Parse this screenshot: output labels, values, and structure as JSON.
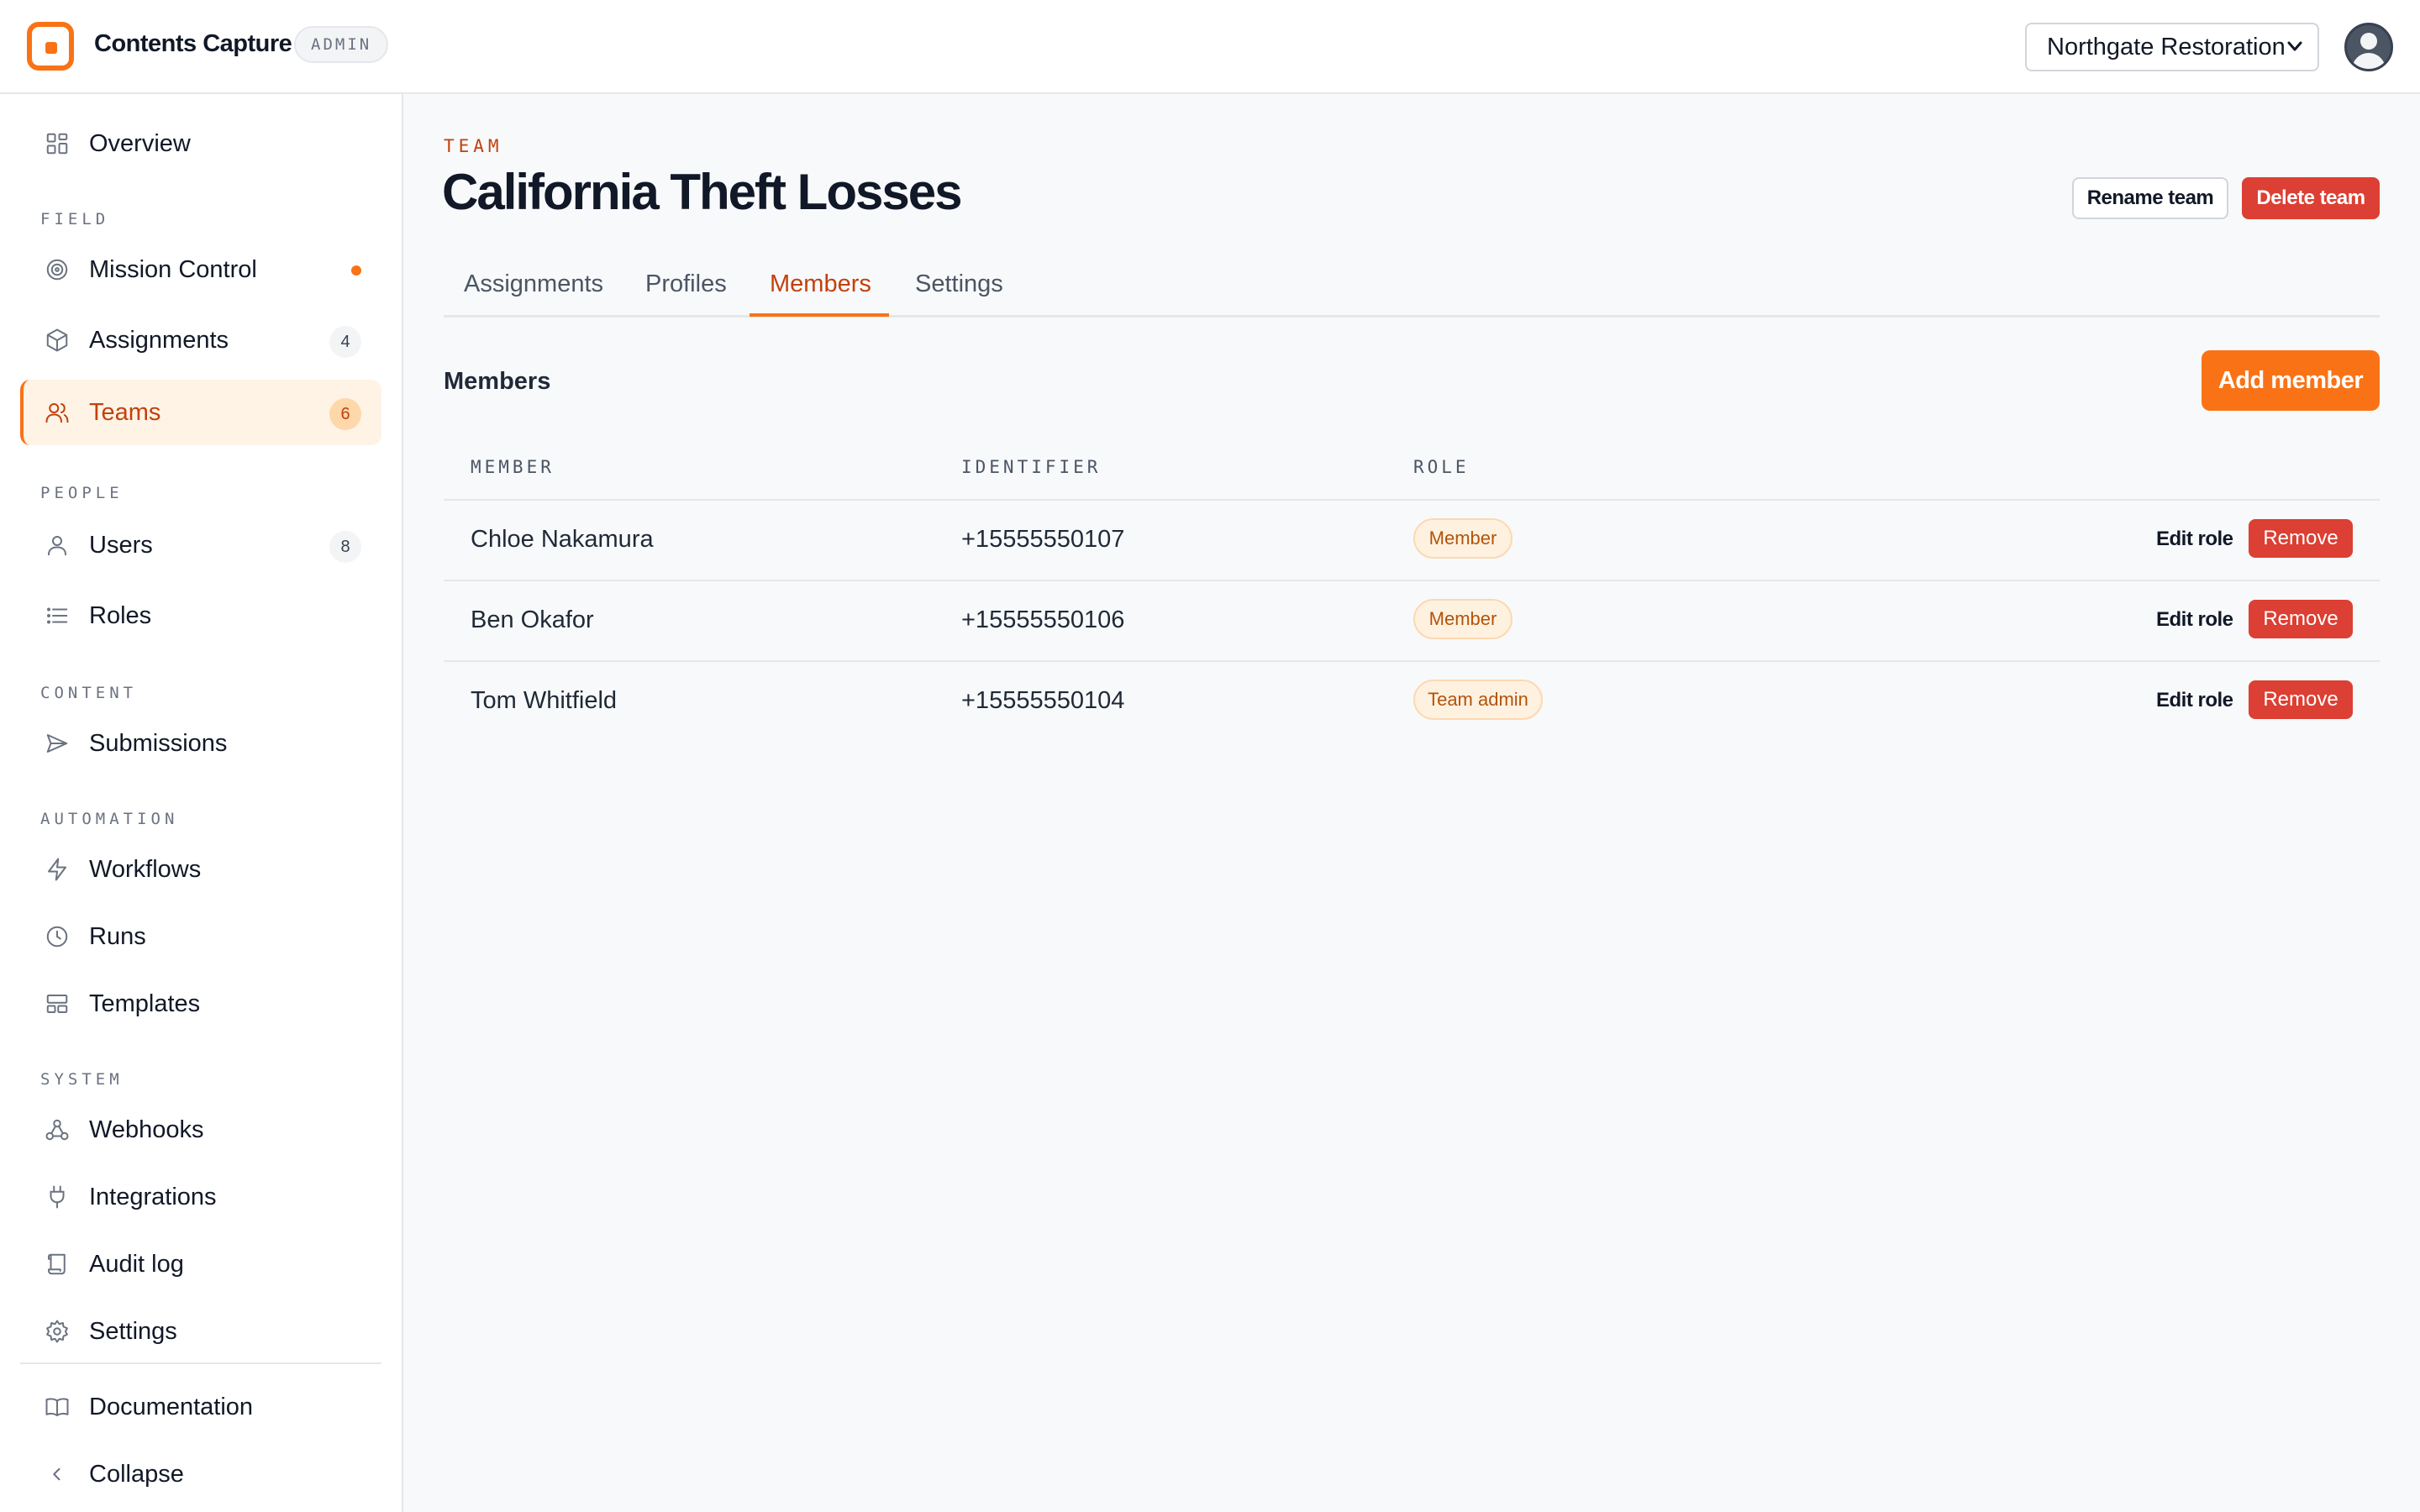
{
  "app": {
    "name": "Contents Capture",
    "badge": "ADMIN",
    "org_selected": "Northgate Restoration"
  },
  "sidebar": {
    "overview": "Overview",
    "sections": {
      "field": "FIELD",
      "people": "PEOPLE",
      "content": "CONTENT",
      "automation": "AUTOMATION",
      "system": "SYSTEM"
    },
    "items": {
      "mission_control": "Mission Control",
      "assignments": "Assignments",
      "assignments_count": "4",
      "teams": "Teams",
      "teams_count": "6",
      "users": "Users",
      "users_count": "8",
      "roles": "Roles",
      "submissions": "Submissions",
      "workflows": "Workflows",
      "runs": "Runs",
      "templates": "Templates",
      "webhooks": "Webhooks",
      "integrations": "Integrations",
      "audit_log": "Audit log",
      "settings": "Settings",
      "documentation": "Documentation",
      "collapse": "Collapse"
    }
  },
  "page": {
    "eyebrow": "TEAM",
    "title": "California Theft Losses",
    "rename_label": "Rename team",
    "delete_label": "Delete team",
    "tabs": [
      "Assignments",
      "Profiles",
      "Members",
      "Settings"
    ],
    "active_tab": "Members",
    "section_title": "Members",
    "add_member_label": "Add member"
  },
  "table": {
    "headers": [
      "MEMBER",
      "IDENTIFIER",
      "ROLE"
    ],
    "rows": [
      {
        "member": "Chloe Nakamura",
        "identifier": "+15555550107",
        "role": "Member"
      },
      {
        "member": "Ben Okafor",
        "identifier": "+15555550106",
        "role": "Member"
      },
      {
        "member": "Tom Whitfield",
        "identifier": "+15555550104",
        "role": "Team admin"
      }
    ],
    "edit_label": "Edit role",
    "remove_label": "Remove"
  },
  "colors": {
    "accent": "#f97316",
    "accent_text": "#c2410c",
    "danger": "#dc3f33"
  }
}
